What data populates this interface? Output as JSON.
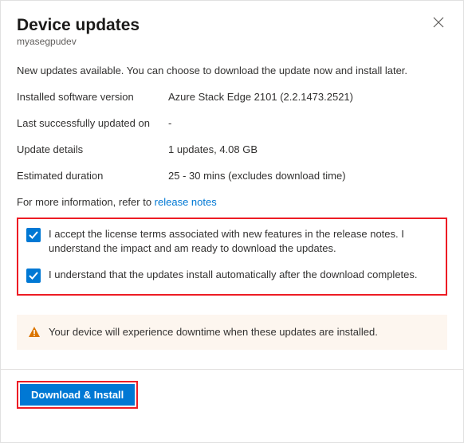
{
  "header": {
    "title": "Device updates",
    "subtitle": "myasegpudev"
  },
  "intro": "New updates available. You can choose to download the update now and install later.",
  "info": {
    "installed_version_label": "Installed software version",
    "installed_version_value": "Azure Stack Edge 2101 (2.2.1473.2521)",
    "last_updated_label": "Last successfully updated on",
    "last_updated_value": "-",
    "update_details_label": "Update details",
    "update_details_value": "1 updates, 4.08 GB",
    "duration_label": "Estimated duration",
    "duration_value": "25 - 30 mins (excludes download time)"
  },
  "more_info": {
    "prefix": "For more information, refer to ",
    "link": "release notes"
  },
  "consent": {
    "license": "I accept the license terms associated with new features in the release notes. I understand the impact and am ready to download the updates.",
    "auto_install": "I understand that the updates install automatically after the download completes."
  },
  "warning": "Your device will experience downtime when these updates are installed.",
  "actions": {
    "download_install": "Download & Install"
  },
  "colors": {
    "accent": "#0078d4",
    "highlight_border": "#ed1c24",
    "warning_bg": "#fdf6ef"
  }
}
